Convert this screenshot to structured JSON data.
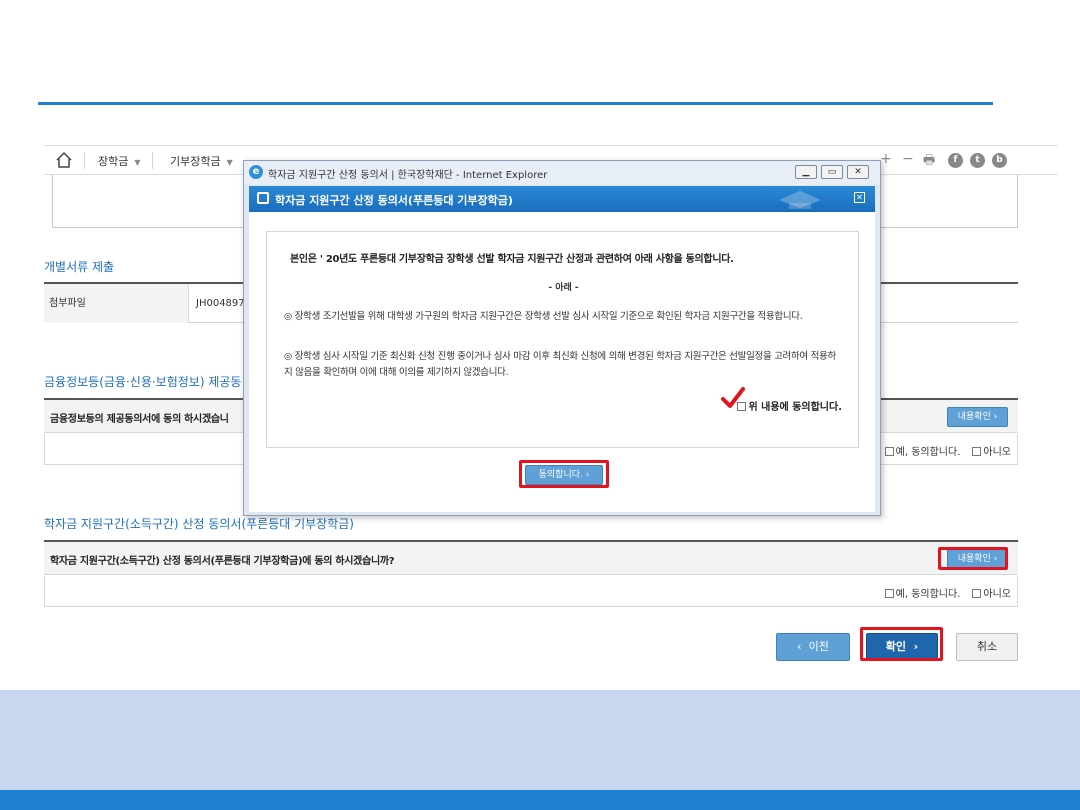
{
  "nav": {
    "items": [
      {
        "label": "장학금"
      },
      {
        "label": "기부장학금"
      }
    ],
    "tool_plus": "+",
    "tool_minus": "−",
    "tool_print": "🖶",
    "social": [
      "f",
      "t",
      "b"
    ]
  },
  "attachment_section": {
    "title": "개별서류 제출",
    "header": "첨부파일",
    "value": "JH004897"
  },
  "finance_section": {
    "title": "금융정보등(금융·신용·보험정보) 제공동",
    "question": "금융정보등의 제공동의서에 동의 하시겠습니",
    "detail_button": "내용확인",
    "yes_label": "예, 동의합니다.",
    "no_label": "아니오"
  },
  "income_section": {
    "title": "학자금 지원구간(소득구간) 산정 동의서(푸른등대 기부장학금)",
    "question": "학자금 지원구간(소득구간) 산정 동의서(푸른등대 기부장학금)에 동의 하시겠습니까?",
    "detail_button": "내용확인",
    "yes_label": "예, 동의합니다.",
    "no_label": "아니오"
  },
  "actions": {
    "prev": "이전",
    "ok": "확인",
    "cancel": "취소"
  },
  "modal": {
    "window_title": "학자금 지원구간 산정 동의서 | 한국장학재단 - Internet Explorer",
    "popup_title": "학자금 지원구간 산정 동의서(푸른등대 기부장학금)",
    "statement": "본인은 ' 20년도 푸른등대 기부장학금 장학생 선발 학자금 지원구간 산정과 관련하여 아래 사항을 동의합니다.",
    "subheading": "- 아래 -",
    "paragraph1": "◎ 장학생 조기선발을 위해 대학생 가구원의 학자금 지원구간은 장학생 선발 심사 시작일 기준으로 확인된 학자금 지원구간을 적용합니다.",
    "paragraph2": "◎ 장학생 심사 시작일 기준 최신화 신청 진행 중이거나 심사 마감 이후 최신화 신청에 의해 변경된 학자금 지원구간은 선발일정을 고려하여 적용하지 않음을 확인하며 이에 대해 이의를 제기하지 않겠습니다.",
    "check_label": "위 내용에 동의합니다.",
    "agree_button": "동의합니다."
  },
  "colors": {
    "accent": "#1f7fd0",
    "highlight": "#e4141e",
    "button_primary": "#1f66ad",
    "button_secondary": "#5fa0d6",
    "footer_band": "#c8d7ef"
  }
}
